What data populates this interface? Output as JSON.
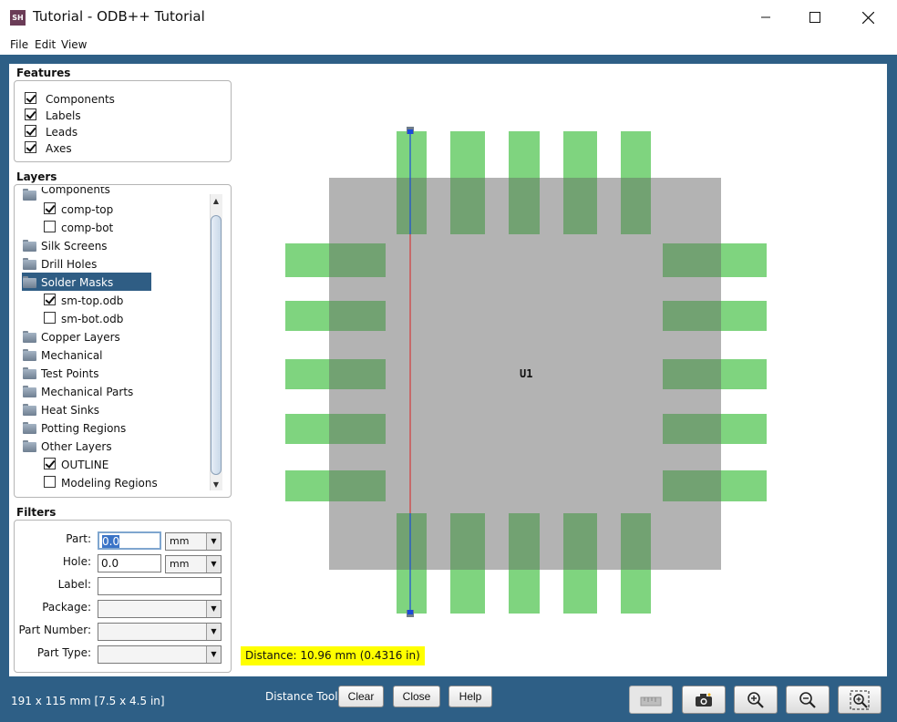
{
  "window": {
    "app_icon_text": "SH",
    "title": "Tutorial - ODB++ Tutorial"
  },
  "menu": [
    "File",
    "Edit",
    "View"
  ],
  "features": {
    "title": "Features",
    "items": [
      {
        "label": "Components",
        "checked": true
      },
      {
        "label": "Labels",
        "checked": true
      },
      {
        "label": "Leads",
        "checked": true
      },
      {
        "label": "Axes",
        "checked": true
      }
    ]
  },
  "layers": {
    "title": "Layers",
    "partial_top_label": "Components",
    "items": [
      {
        "label": "comp-top",
        "type": "check",
        "checked": true
      },
      {
        "label": "comp-bot",
        "type": "check",
        "checked": false
      },
      {
        "label": "Silk Screens",
        "type": "folder"
      },
      {
        "label": "Drill Holes",
        "type": "folder"
      },
      {
        "label": "Solder Masks",
        "type": "folder",
        "selected": true
      },
      {
        "label": "sm-top.odb",
        "type": "check",
        "checked": true
      },
      {
        "label": "sm-bot.odb",
        "type": "check",
        "checked": false
      },
      {
        "label": "Copper Layers",
        "type": "folder"
      },
      {
        "label": "Mechanical",
        "type": "folder"
      },
      {
        "label": "Test Points",
        "type": "folder"
      },
      {
        "label": "Mechanical Parts",
        "type": "folder"
      },
      {
        "label": "Heat Sinks",
        "type": "folder"
      },
      {
        "label": "Potting Regions",
        "type": "folder"
      },
      {
        "label": "Other Layers",
        "type": "folder"
      },
      {
        "label": "OUTLINE",
        "type": "check",
        "checked": true
      },
      {
        "label": "Modeling Regions",
        "type": "check",
        "checked": false
      }
    ]
  },
  "filters": {
    "title": "Filters",
    "part_label": "Part:",
    "part_value": "0.0",
    "part_unit": "mm",
    "hole_label": "Hole:",
    "hole_value": "0.0",
    "hole_unit": "mm",
    "label_label": "Label:",
    "package_label": "Package:",
    "part_number_label": "Part Number:",
    "part_type_label": "Part Type:"
  },
  "canvas": {
    "component_label": "U1",
    "distance_readout": "Distance: 10.96 mm  (0.4316 in)",
    "colors": {
      "body": "#b3b3b3",
      "pad": "#7fd47f",
      "pad_overlap": "#72a272",
      "measure_line": "#d23a3a",
      "measure_line_ends": "#1a4bd8"
    }
  },
  "statusbar": {
    "size_text": "191 x 115 mm  [7.5 x 4.5 in]",
    "tool_label": "Distance Tool",
    "clear_label": "Clear",
    "close_label": "Close",
    "help_label": "Help"
  },
  "toolbar_icons": [
    "measure-icon",
    "camera-icon",
    "zoom-in-icon",
    "zoom-out-icon",
    "zoom-fit-icon"
  ]
}
